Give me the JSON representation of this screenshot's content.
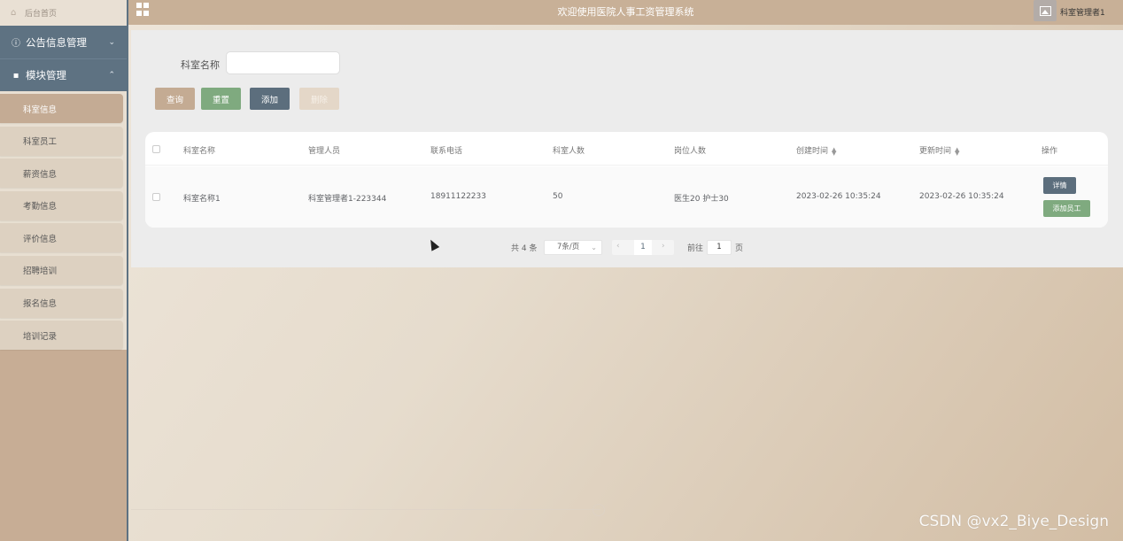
{
  "app": {
    "title": "欢迎使用医院人事工资管理系统",
    "user_name": "科室管理者1",
    "watermark": "CSDN @vx2_Biye_Design"
  },
  "sidebar": {
    "home_label": "后台首页",
    "groups": [
      {
        "label": "公告信息管理",
        "icon": "info-circle-icon",
        "expanded": false
      },
      {
        "label": "模块管理",
        "icon": "grid-icon",
        "expanded": true
      }
    ],
    "items": [
      {
        "label": "科室信息",
        "active": true
      },
      {
        "label": "科室员工"
      },
      {
        "label": "薪资信息"
      },
      {
        "label": "考勤信息"
      },
      {
        "label": "评价信息"
      },
      {
        "label": "招聘培训"
      },
      {
        "label": "报名信息"
      },
      {
        "label": "培训记录"
      }
    ]
  },
  "search": {
    "label": "科室名称",
    "value": "",
    "placeholder": ""
  },
  "buttons": {
    "query": "查询",
    "reset": "重置",
    "add": "添加",
    "delete": "删除"
  },
  "table": {
    "headers": [
      "科室名称",
      "管理人员",
      "联系电话",
      "科室人数",
      "岗位人数",
      "创建时间",
      "更新时间",
      "操作"
    ],
    "rows": [
      {
        "name": "科室名称1",
        "manager": "科室管理者1-223344",
        "phone": "18911122233",
        "count": "50",
        "positions": "医生20 护士30",
        "created": "2023-02-26 10:35:24",
        "updated": "2023-02-26 10:35:24",
        "actions": {
          "detail": "详情",
          "add_employee": "添加员工"
        }
      }
    ]
  },
  "pagination": {
    "total": "共 4 条",
    "page_size": "7条/页",
    "current_page": "1",
    "goto_label": "前往",
    "goto_value": "1",
    "page_suffix": "页"
  },
  "colors": {
    "sidebar_group": "#5e7282",
    "topbar": "#c8b097",
    "btn_query": "#c4ab93",
    "btn_reset": "#7faa7f",
    "btn_add": "#5c6e7d",
    "btn_delete": "#e4d7c8"
  }
}
